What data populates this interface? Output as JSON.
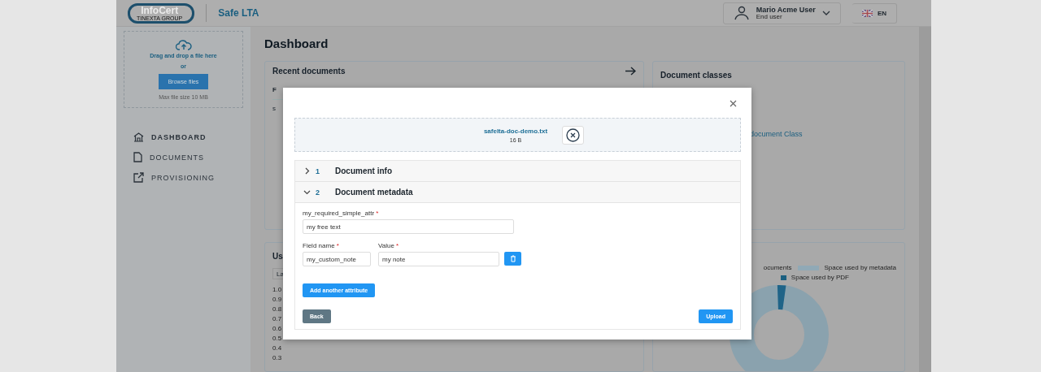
{
  "header": {
    "logo": "InfoCert",
    "logo_tagline": "TINEXTA GROUP",
    "app_name": "Safe LTA",
    "user": {
      "name": "Mario Acme User",
      "role": "End user"
    },
    "language": "EN"
  },
  "sidebar": {
    "upload": {
      "title": "Drag and drop a file here",
      "or": "or",
      "button": "Browse files",
      "hint": "Max file size 10 MB"
    },
    "items": [
      {
        "label": "DASHBOARD",
        "selected": true
      },
      {
        "label": "DOCUMENTS",
        "selected": false
      },
      {
        "label": "PROVISIONING",
        "selected": false
      }
    ]
  },
  "page_title": "Dashboard",
  "recent_documents": {
    "title": "Recent documents",
    "column_1": "F",
    "row_1": "s"
  },
  "document_classes": {
    "title": "Document classes",
    "link": "document Class"
  },
  "usage_card": {
    "title": "Us",
    "select": "La",
    "y_labels": [
      "1.0",
      "0.9",
      "0.8",
      "0.7",
      "0.6",
      "0.5",
      "0.4",
      "0.3"
    ]
  },
  "space_card": {
    "legend": [
      {
        "label": "ocuments"
      },
      {
        "label": "Space used by metadata",
        "color": "#90a9b6"
      },
      {
        "label": "Space used by PDF",
        "color": "#1b5f80"
      }
    ]
  },
  "modal": {
    "file": {
      "name": "safelta-doc-demo.txt",
      "size": "16 B"
    },
    "sections": [
      {
        "number": "1",
        "title": "Document info",
        "expanded": false
      },
      {
        "number": "2",
        "title": "Document metadata",
        "expanded": true
      }
    ],
    "required_attr": {
      "label": "my_required_simple_attr",
      "required_mark": "*",
      "value": "my free text"
    },
    "custom_attr": {
      "name_label": "Field name",
      "name_required_mark": "*",
      "name_value": "my_custom_note",
      "value_label": "Value",
      "value_required_mark": "*",
      "value": "my note"
    },
    "add_button": "Add another attribute",
    "back_button": "Back",
    "upload_button": "Upload"
  }
}
